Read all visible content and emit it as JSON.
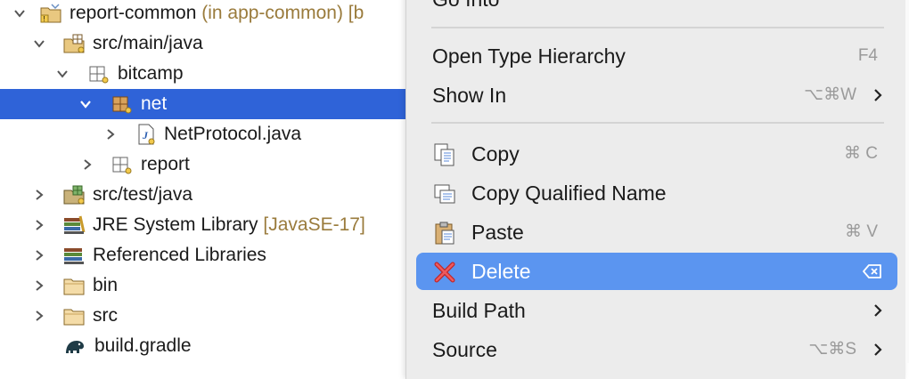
{
  "tree": {
    "rows": [
      {
        "label": "report-common",
        "decoration": " (in app-common) [b"
      },
      {
        "label": "src/main/java"
      },
      {
        "label": "bitcamp"
      },
      {
        "label": "net"
      },
      {
        "label": "NetProtocol.java"
      },
      {
        "label": "report"
      },
      {
        "label": "src/test/java"
      },
      {
        "label": "JRE System Library",
        "decoration": " [JavaSE-17]"
      },
      {
        "label": "Referenced Libraries"
      },
      {
        "label": "bin"
      },
      {
        "label": "src"
      },
      {
        "label": "build.gradle"
      }
    ]
  },
  "menu": {
    "partial_top": "Go Into",
    "items": [
      {
        "label": "Open Type Hierarchy",
        "shortcut": "F4"
      },
      {
        "label": "Show In",
        "shortcut": "⌥⌘W"
      },
      {
        "label": "Copy",
        "shortcut": "⌘ C"
      },
      {
        "label": "Copy Qualified Name",
        "shortcut": ""
      },
      {
        "label": "Paste",
        "shortcut": "⌘ V"
      },
      {
        "label": "Delete",
        "shortcut": ""
      },
      {
        "label": "Build Path",
        "shortcut": ""
      },
      {
        "label": "Source",
        "shortcut": "⌥⌘S"
      }
    ]
  },
  "colors": {
    "selection": "#2f63d8",
    "menu_highlight": "#5b95f0",
    "menu_background": "#ececec"
  }
}
